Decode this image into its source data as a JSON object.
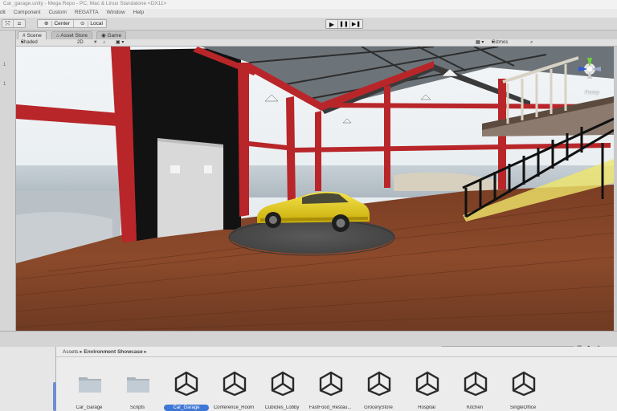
{
  "window": {
    "title": "Car_garage.unity - Mega Repo - PC, Mac & Linux Standalone <DX11>"
  },
  "menu": {
    "items": [
      "dit",
      "Component",
      "Custom",
      "REGATTA",
      "Window",
      "Help"
    ]
  },
  "toolbar": {
    "pivot_label": "Center",
    "space_label": "Local"
  },
  "tabs": [
    {
      "label": "Scene",
      "icon": "scene-icon"
    },
    {
      "label": "Asset Store",
      "icon": "store-icon"
    },
    {
      "label": "Game",
      "icon": "game-icon"
    }
  ],
  "scene_toolbar": {
    "draw_mode": "Shaded",
    "mode_2d": "2D",
    "gizmos_label": "Gizmos"
  },
  "scene": {
    "projection_label": "Persp"
  },
  "hierarchy": {
    "markers": [
      "1",
      "1"
    ]
  },
  "project": {
    "breadcrumb_root": "Assets",
    "breadcrumb_folder": "Environment Showcase",
    "assets": [
      {
        "label": "Car_Garage",
        "kind": "folder",
        "selected": false
      },
      {
        "label": "Scripts",
        "kind": "folder",
        "selected": false
      },
      {
        "label": "Car_Garage",
        "kind": "unity-scene",
        "selected": true
      },
      {
        "label": "Conference_Room",
        "kind": "unity-scene",
        "selected": false
      },
      {
        "label": "Cubicles_Lobby",
        "kind": "unity-scene",
        "selected": false
      },
      {
        "label": "FastFood_Restau...",
        "kind": "unity-scene",
        "selected": false
      },
      {
        "label": "GroceryStore",
        "kind": "unity-scene",
        "selected": false
      },
      {
        "label": "Hospital",
        "kind": "unity-scene",
        "selected": false
      },
      {
        "label": "Kitchen",
        "kind": "unity-scene",
        "selected": false
      },
      {
        "label": "SingleOffice",
        "kind": "unity-scene",
        "selected": false
      }
    ]
  },
  "colors": {
    "selection": "#3f77d6",
    "beam": "#b8262a",
    "car": "#e6cf12"
  }
}
